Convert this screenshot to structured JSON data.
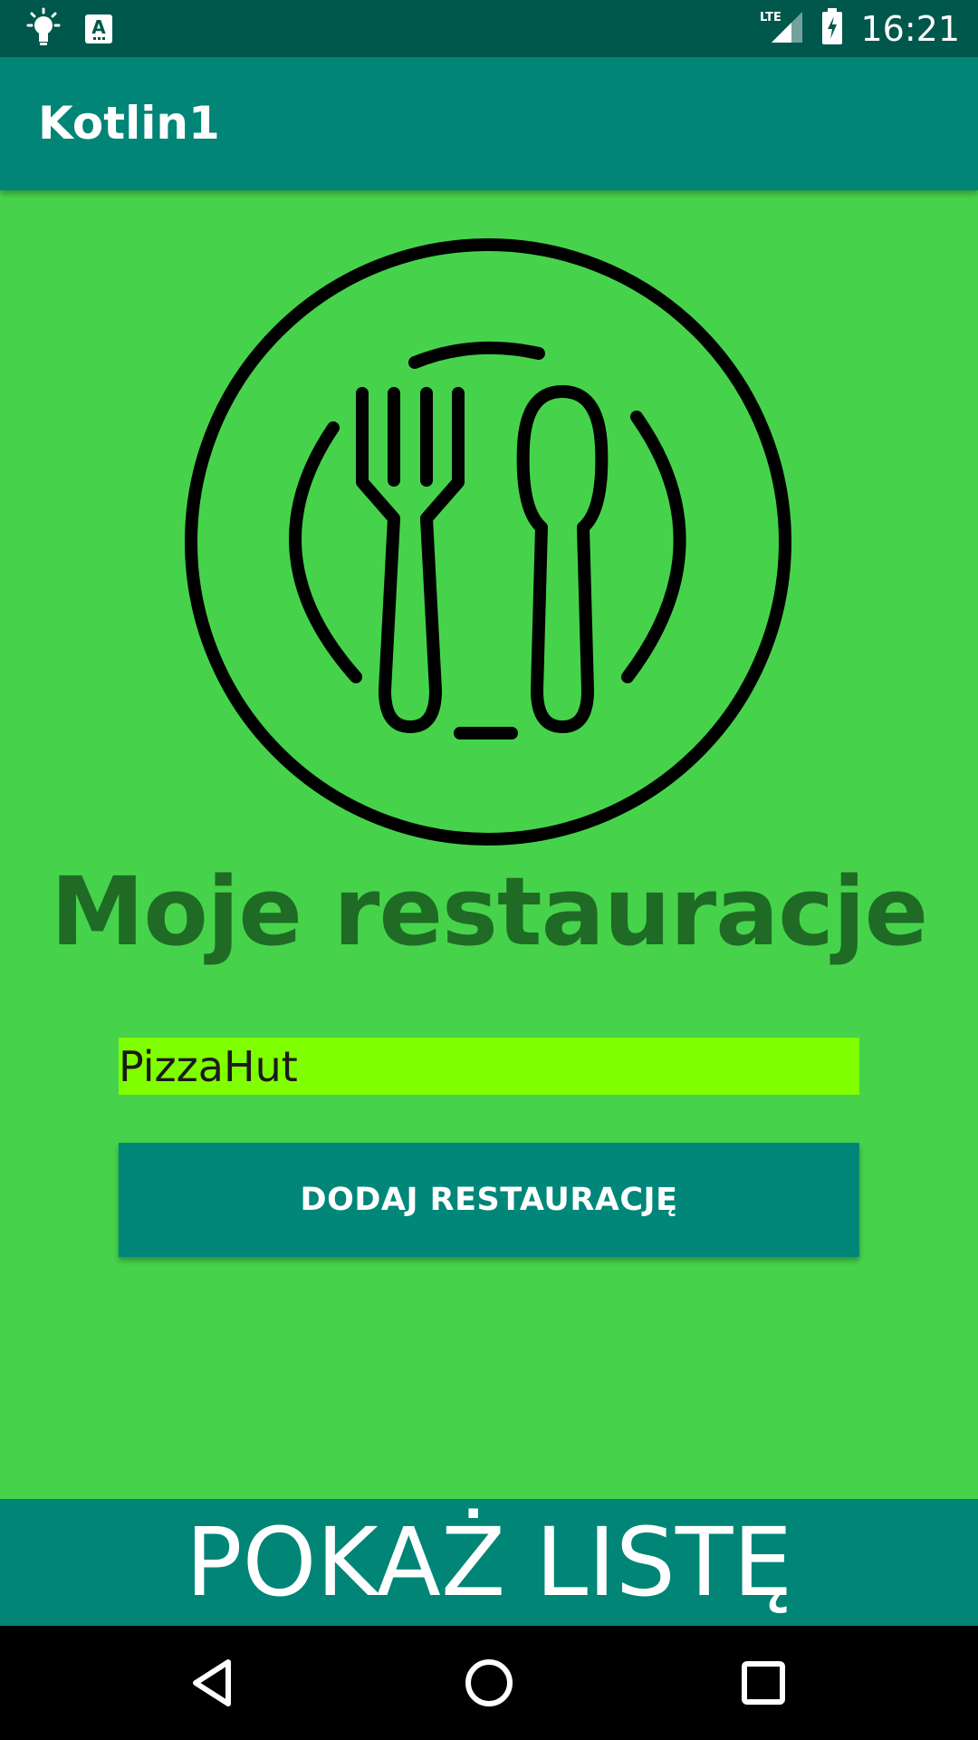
{
  "status_bar": {
    "time": "16:21",
    "icons": [
      "lightbulb-icon",
      "accessibility-a-icon",
      "lte-signal-icon",
      "battery-charging-icon"
    ],
    "network_label": "LTE"
  },
  "app_bar": {
    "title": "Kotlin1"
  },
  "main": {
    "logo_icon": "plate-fork-spoon-icon",
    "headline": "Moje restauracje",
    "restaurant_input": {
      "value": "PizzaHut",
      "placeholder": ""
    },
    "add_button_label": "DODAJ RESTAURACJĘ"
  },
  "footer": {
    "show_list_label": "POKAŻ LISTĘ"
  },
  "nav_bar": {
    "buttons": [
      "back-icon",
      "home-icon",
      "recents-icon"
    ]
  },
  "colors": {
    "background": "#46d34b",
    "status_bar": "#00574b",
    "app_bar": "#008577",
    "headline": "#1f6b25",
    "input_bg": "#80ff00",
    "button": "#00877a"
  }
}
